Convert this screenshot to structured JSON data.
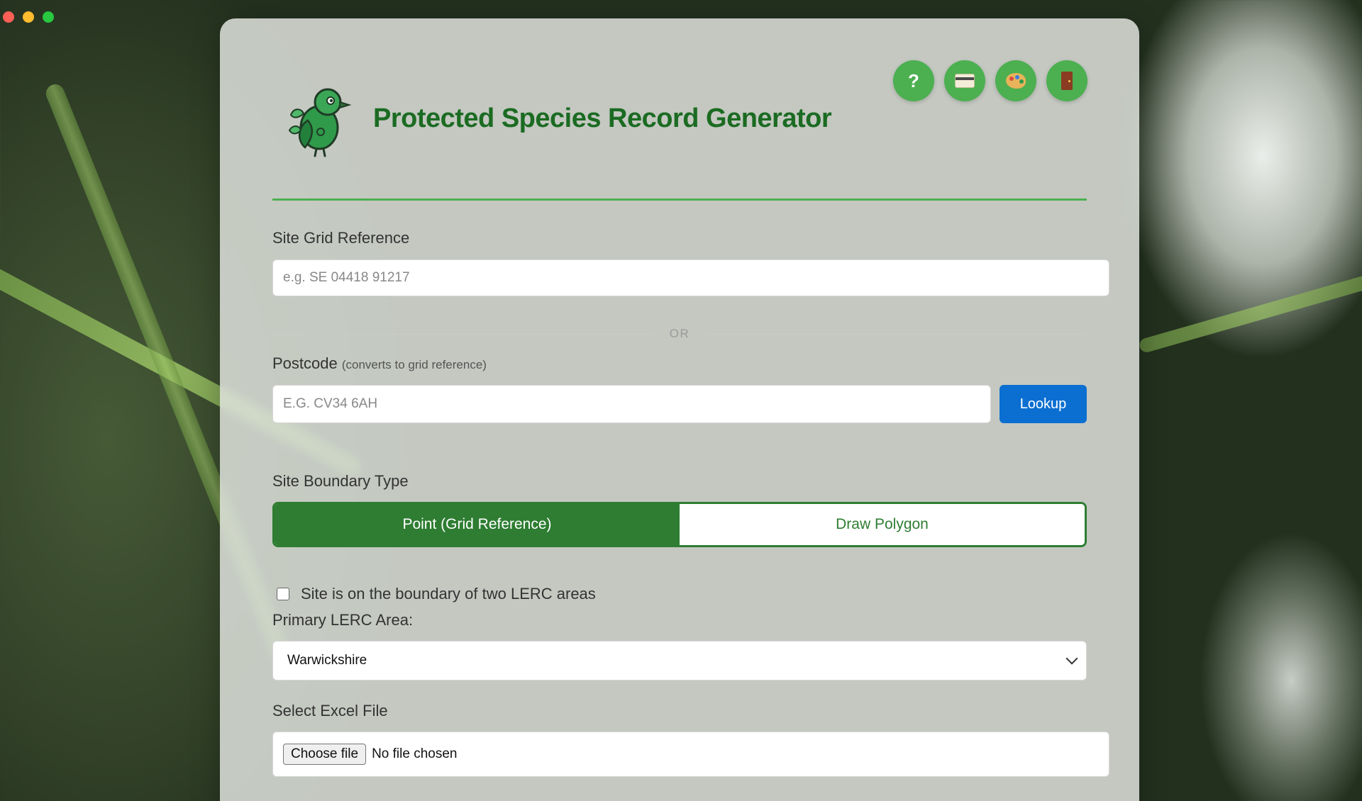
{
  "window": {
    "controls": [
      "close",
      "minimize",
      "zoom"
    ]
  },
  "header": {
    "title": "Protected Species Record Generator",
    "logo_icon": "bird-logo-icon",
    "toolbar": [
      {
        "name": "help",
        "icon": "question-icon",
        "glyph": "?"
      },
      {
        "name": "billing",
        "icon": "credit-card-icon"
      },
      {
        "name": "theme",
        "icon": "palette-icon"
      },
      {
        "name": "logout",
        "icon": "door-icon"
      }
    ]
  },
  "form": {
    "grid_ref": {
      "label": "Site Grid Reference",
      "placeholder": "e.g. SE 04418 91217",
      "value": ""
    },
    "separator": "OR",
    "postcode": {
      "label": "Postcode",
      "hint": "(converts to grid reference)",
      "placeholder": "E.G. CV34 6AH",
      "value": "",
      "button": "Lookup"
    },
    "boundary": {
      "label": "Site Boundary Type",
      "options": [
        "Point (Grid Reference)",
        "Draw Polygon"
      ],
      "selected": "Point (Grid Reference)"
    },
    "two_lerc": {
      "label": "Site is on the boundary of two LERC areas",
      "checked": false
    },
    "primary_lerc": {
      "label": "Primary LERC Area:",
      "value": "Warwickshire"
    },
    "excel": {
      "label": "Select Excel File",
      "button": "Choose file",
      "status": "No file chosen"
    }
  },
  "colors": {
    "brand_green": "#1b6b22",
    "accent_green": "#4caf50",
    "segment_green": "#2e7d32",
    "lookup_blue": "#0b6fd1"
  }
}
